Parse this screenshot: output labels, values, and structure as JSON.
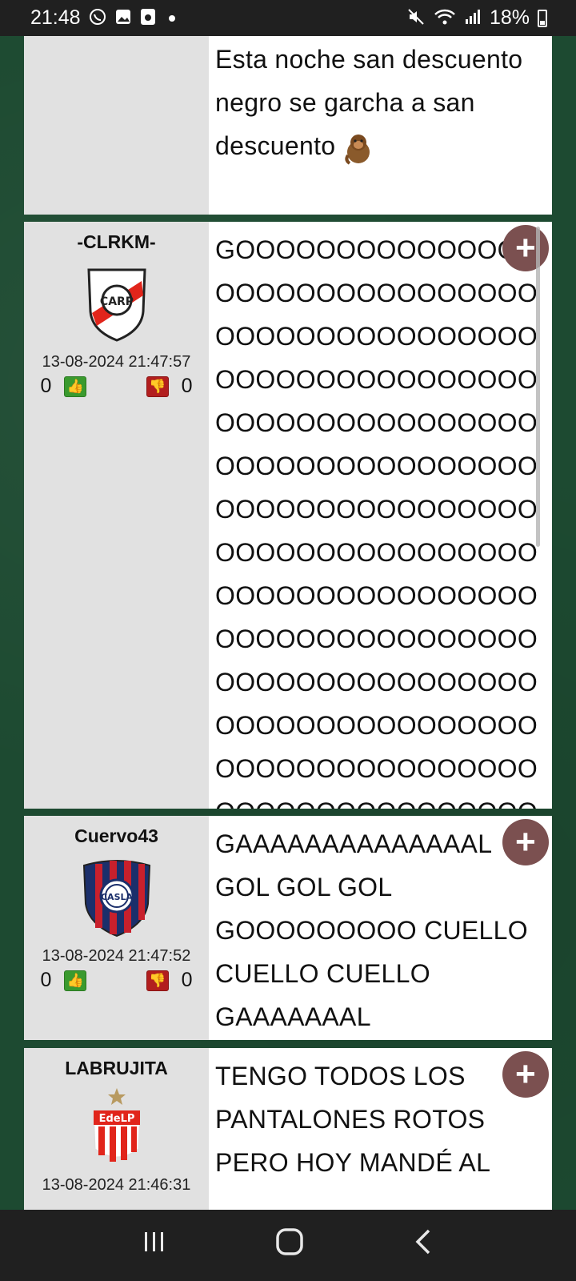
{
  "status_bar": {
    "time": "21:48",
    "battery_percent": "18%",
    "left_icons": [
      "whatsapp-icon",
      "gallery-icon",
      "app-icon",
      "dot-icon"
    ],
    "right_icons": [
      "mute-icon",
      "wifi-icon",
      "signal-icon",
      "battery-icon"
    ]
  },
  "posts": [
    {
      "username": "",
      "timestamp": "",
      "likes": "",
      "dislikes": "",
      "text": "Esta noche san descuento negro se garcha a san descuento",
      "emoji": "monkey-emoji"
    },
    {
      "username": "-CLRKM-",
      "crest": "river-plate-crest",
      "timestamp": "13-08-2024 21:47:57",
      "likes": "0",
      "dislikes": "0",
      "text": "GOOOOOOOOOOOOOOOOOOOOOOOOOOOOOOOOOOOOOOOOOOOOOOOOOOOOOOOOOOOOOOOOOOOOOOOOOOOOOOOOOOOOOOOOOOOOOOOOOOOOOOOOOOOOOOOOOOOOOOOOOOOOOOOOOOOOOOOOOOOOOOOOOOOOOOOOOOOOOOOOOOOOOOOOOOOOOOOOOOOOOOOOOOOOOOOOOOOOOOOOOOOOOOOOOOOOOOOOOOOOOOOOOOOOOOOOOOO"
    },
    {
      "username": "Cuervo43",
      "crest": "san-lorenzo-crest",
      "timestamp": "13-08-2024 21:47:52",
      "likes": "0",
      "dislikes": "0",
      "text": "GAAAAAAAAAAAAAAL GOL GOL GOL GOOOOOOOOO CUELLO CUELLO CUELLO GAAAAAAAL"
    },
    {
      "username": "LABRUJITA",
      "crest": "estudiantes-crest",
      "crest_text": "EdeLP",
      "timestamp": "13-08-2024 21:46:31",
      "text": "TENGO TODOS LOS PANTALONES ROTOS PERO HOY MANDÉ AL"
    }
  ],
  "colors": {
    "background": "#1d4a31",
    "side_panel": "#e1e1e1",
    "plus_button": "#7b5050",
    "thumb_up": "#3a9a2e",
    "thumb_down": "#b21e1e"
  },
  "nav_bar": {
    "recent": "recent-apps-icon",
    "home": "home-icon",
    "back": "back-icon"
  }
}
